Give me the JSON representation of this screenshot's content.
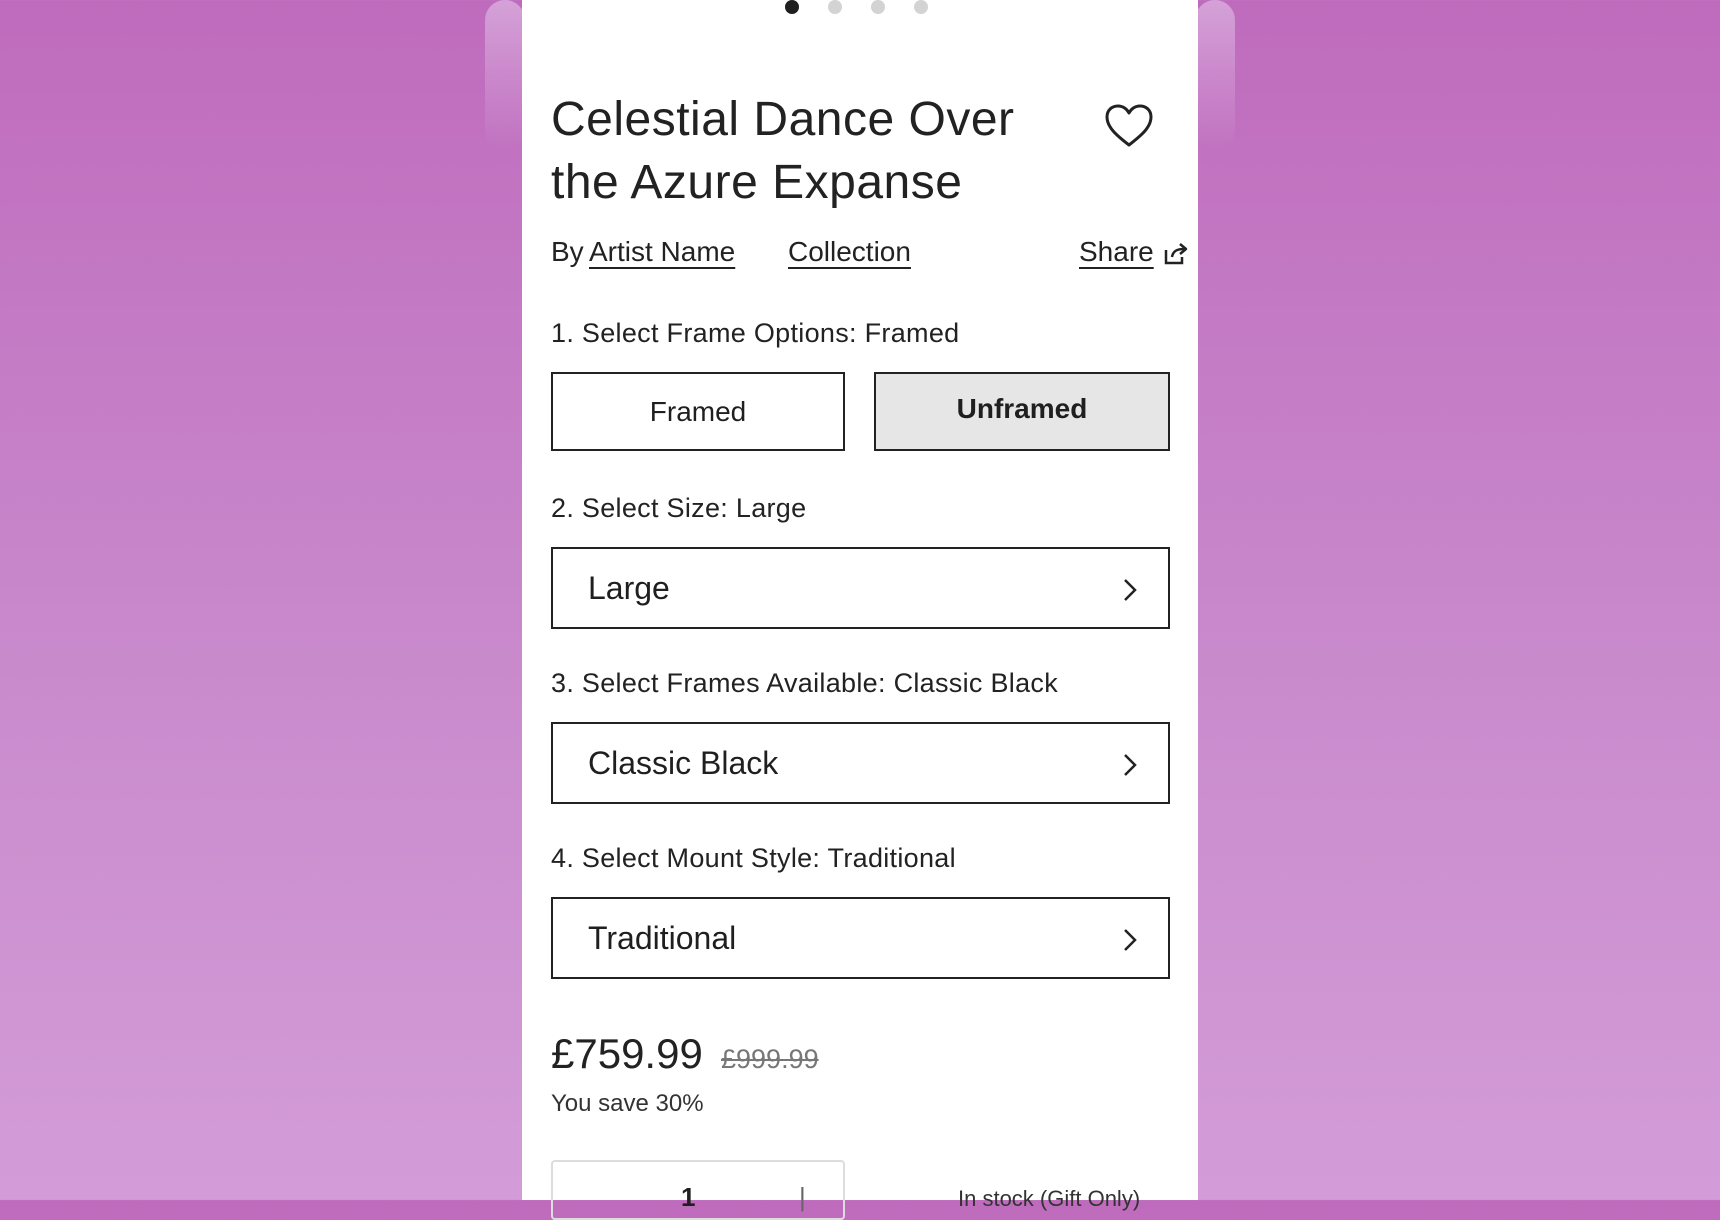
{
  "carousel": {
    "dots": 4,
    "active_index": 0
  },
  "product": {
    "title": "Celestial Dance Over the Azure Expanse",
    "by_prefix": "By",
    "artist": "Artist Name",
    "collection": "Collection",
    "share": "Share"
  },
  "options": {
    "frame_label": "1. Select Frame Options: Framed",
    "framed": "Framed",
    "unframed": "Unframed",
    "size_label": "2. Select Size: Large",
    "size_value": "Large",
    "frames_label": "3. Select Frames Available: Classic Black",
    "frames_value": "Classic Black",
    "mount_label": "4. Select Mount Style: Traditional",
    "mount_value": "Traditional"
  },
  "pricing": {
    "price": "£759.99",
    "old_price": "£999.99",
    "savings": "You save 30%"
  },
  "purchase": {
    "quantity": "1",
    "stock": "In stock (Gift Only)"
  },
  "colors": {
    "background": "#c47cc4",
    "panel": "#ffffff",
    "selected_option": "#e6e6e6"
  },
  "icons": [
    "heart-icon",
    "share-icon",
    "chevron-right-icon"
  ]
}
